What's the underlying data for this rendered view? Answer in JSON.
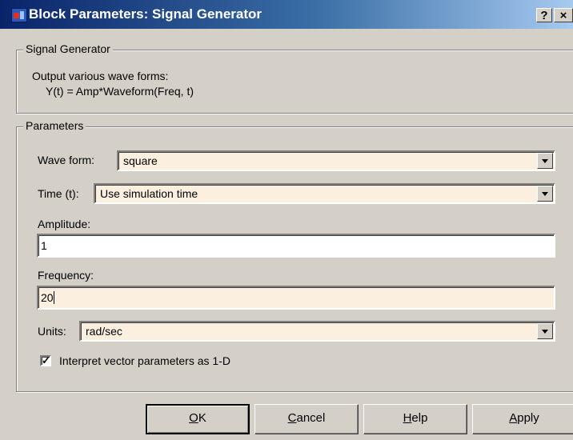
{
  "window": {
    "title": "Block Parameters: Signal Generator",
    "help_glyph": "?",
    "close_glyph": "×"
  },
  "description": {
    "group_label": "Signal Generator",
    "line1": "Output various wave forms:",
    "line2": "Y(t) = Amp*Waveform(Freq, t)"
  },
  "parameters": {
    "group_label": "Parameters",
    "waveform": {
      "label": "Wave form:",
      "value": "square"
    },
    "time": {
      "label": "Time (t):",
      "value": "Use simulation time"
    },
    "amplitude": {
      "label": "Amplitude:",
      "value": "1"
    },
    "frequency": {
      "label": "Frequency:",
      "value": "20"
    },
    "units": {
      "label": "Units:",
      "value": "rad/sec"
    },
    "interpret_vector": {
      "label": "Interpret vector parameters as 1-D",
      "checked": true
    }
  },
  "buttons": {
    "ok": {
      "mnemonic": "O",
      "rest": "K"
    },
    "cancel": {
      "mnemonic": "C",
      "rest": "ancel"
    },
    "help": {
      "mnemonic": "H",
      "rest": "elp"
    },
    "apply": {
      "mnemonic": "A",
      "rest": "pply"
    }
  },
  "colors": {
    "titlebar_start": "#0a246a",
    "titlebar_end": "#a6caf0",
    "dialog_face": "#d4d0c8",
    "field_background": "#fbf0e0"
  }
}
